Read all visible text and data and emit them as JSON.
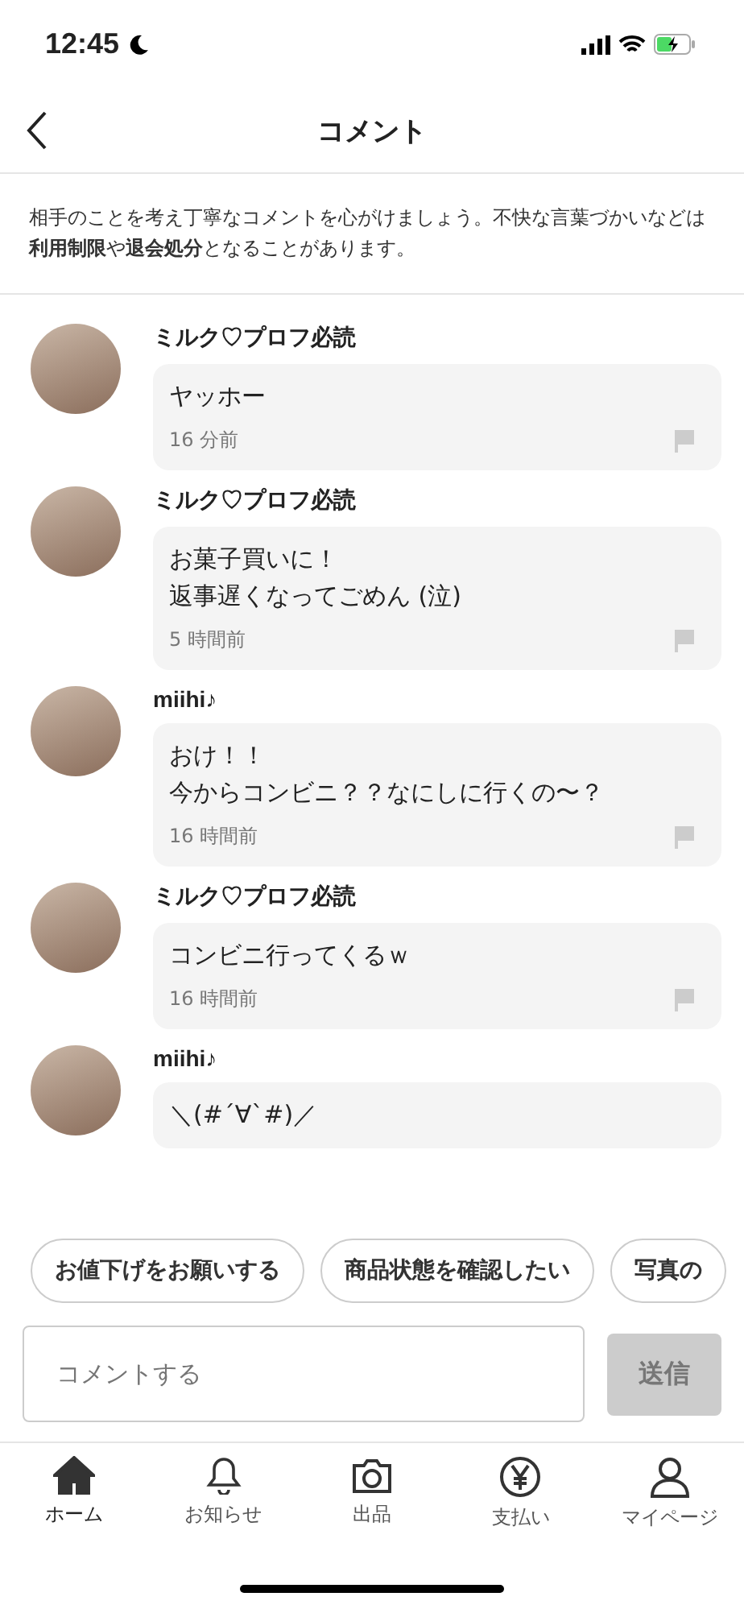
{
  "status_bar": {
    "time": "12:45"
  },
  "header": {
    "title": "コメント"
  },
  "notice": "相手のことを考え丁寧なコメントを心がけましょう。不快な言葉づかいなどは**利用制限**や**退会処分**となることがあります。",
  "comments": [
    {
      "name": "ミルク♡プロフ必読",
      "lines": [
        "ヤッホー"
      ],
      "time": "16 分前"
    },
    {
      "name": "ミルク♡プロフ必読",
      "lines": [
        "お菓子買いに！",
        "返事遅くなってごめん (泣)"
      ],
      "time": "5 時間前"
    },
    {
      "name": "miihi♪",
      "lines": [
        "おけ！！",
        "今からコンビニ？？なにしに行くの〜？"
      ],
      "time": "16 時間前"
    },
    {
      "name": "ミルク♡プロフ必読",
      "lines": [
        "コンビニ行ってくるｗ"
      ],
      "time": "16 時間前"
    },
    {
      "name": "miihi♪",
      "lines": [
        "＼(#´∀`#)／"
      ]
    }
  ],
  "quick_replies": [
    "お値下げをお願いする",
    "商品状態を確認したい",
    "写真の"
  ],
  "composer": {
    "placeholder": "コメントする",
    "send": "送信"
  },
  "tab_bar": [
    {
      "label": "ホーム",
      "kind": "home",
      "selected": true
    },
    {
      "label": "お知らせ",
      "kind": "bell",
      "selected": false
    },
    {
      "label": "出品",
      "kind": "camera",
      "selected": false
    },
    {
      "label": "支払い",
      "kind": "yen",
      "selected": false
    },
    {
      "label": "マイページ",
      "kind": "person",
      "selected": false
    }
  ]
}
